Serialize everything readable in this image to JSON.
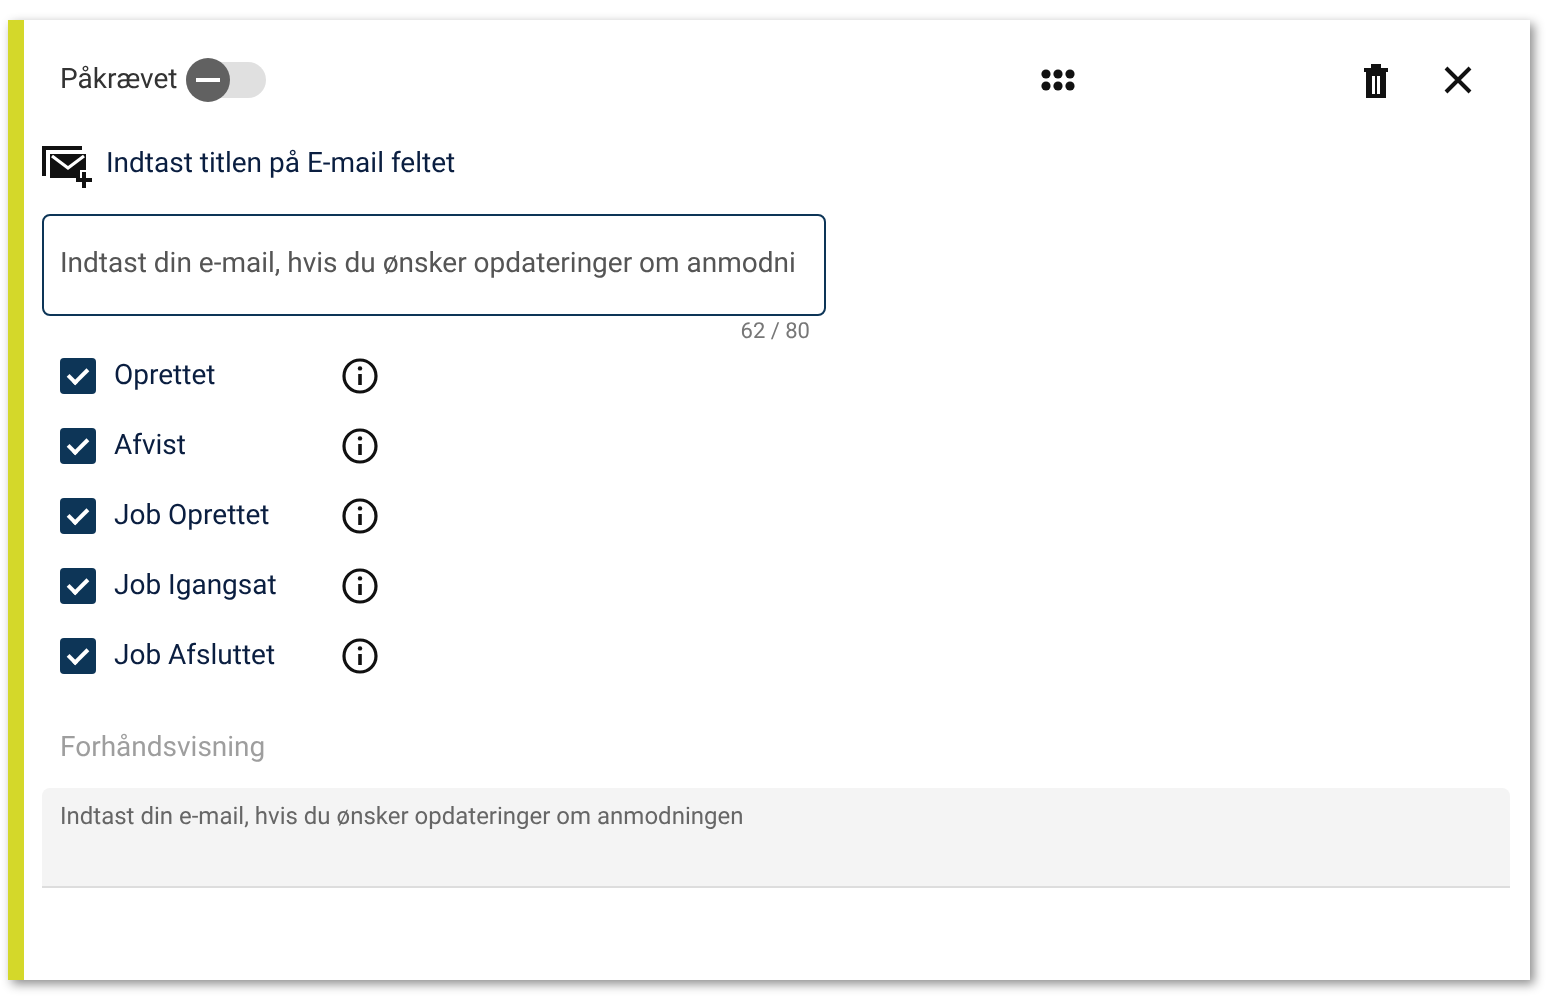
{
  "header": {
    "required_label": "Påkrævet",
    "required_on": false
  },
  "title": "Indtast titlen på E-mail feltet",
  "field": {
    "value": "Indtast din e-mail, hvis du ønsker opdateringer om anmodni",
    "counter": "62 / 80"
  },
  "options": [
    {
      "label": "Oprettet",
      "checked": true
    },
    {
      "label": "Afvist",
      "checked": true
    },
    {
      "label": "Job Oprettet",
      "checked": true
    },
    {
      "label": "Job Igangsat",
      "checked": true
    },
    {
      "label": "Job Afsluttet",
      "checked": true
    }
  ],
  "preview": {
    "label": "Forhåndsvisning",
    "text": "Indtast din e-mail, hvis du ønsker opdateringer om anmodningen"
  }
}
